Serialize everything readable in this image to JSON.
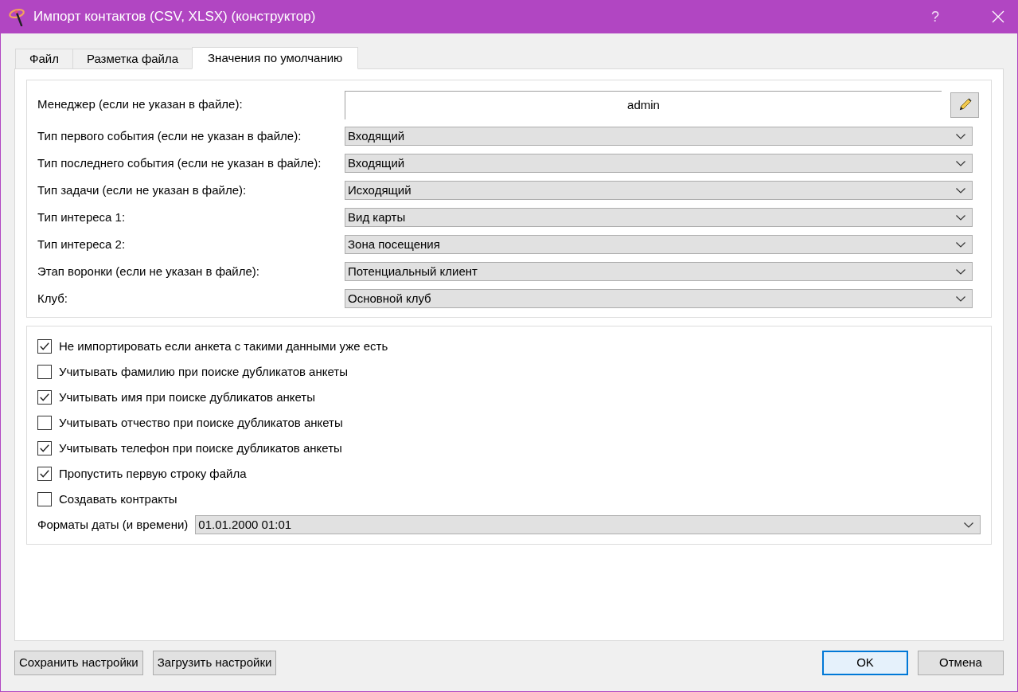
{
  "window": {
    "title": "Импорт контактов (CSV, XLSX) (конструктор)",
    "help_button": "?"
  },
  "tabs": [
    {
      "label": "Файл",
      "selected": false
    },
    {
      "label": "Разметка файла",
      "selected": false
    },
    {
      "label": "Значения по умолчанию",
      "selected": true
    }
  ],
  "defaults": [
    {
      "kind": "text",
      "label": "Менеджер (если не указан в файле):",
      "value": "admin"
    },
    {
      "kind": "combo",
      "label": "Тип первого события (если не указан в файле):",
      "value": "Входящий"
    },
    {
      "kind": "combo",
      "label": "Тип последнего события (если не указан в файле):",
      "value": "Входящий"
    },
    {
      "kind": "combo",
      "label": "Тип задачи (если не указан в файле):",
      "value": "Исходящий"
    },
    {
      "kind": "combo",
      "label": "Тип интереса 1:",
      "value": "Вид карты"
    },
    {
      "kind": "combo",
      "label": "Тип интереса 2:",
      "value": "Зона посещения"
    },
    {
      "kind": "combo",
      "label": "Этап воронки (если не указан в файле):",
      "value": "Потенциальный клиент"
    },
    {
      "kind": "combo",
      "label": "Клуб:",
      "value": "Основной клуб"
    }
  ],
  "options": [
    {
      "label": "Не импортировать если анкета с такими данными уже есть",
      "checked": true
    },
    {
      "label": "Учитывать фамилию при поиске дубликатов анкеты",
      "checked": false
    },
    {
      "label": "Учитывать имя при поиске дубликатов анкеты",
      "checked": true
    },
    {
      "label": "Учитывать отчество при поиске дубликатов анкеты",
      "checked": false
    },
    {
      "label": "Учитывать телефон при поиске дубликатов анкеты",
      "checked": true
    },
    {
      "label": "Пропустить первую строку файла",
      "checked": true
    },
    {
      "label": "Создавать контракты",
      "checked": false
    }
  ],
  "date_format": {
    "label": "Форматы даты (и времени)",
    "value": "01.01.2000 01:01"
  },
  "buttons_left": [
    "Сохранить настройки",
    "Загрузить настройки"
  ],
  "buttons_right": [
    {
      "label": "OK",
      "default": true
    },
    {
      "label": "Отмена",
      "default": false
    }
  ]
}
